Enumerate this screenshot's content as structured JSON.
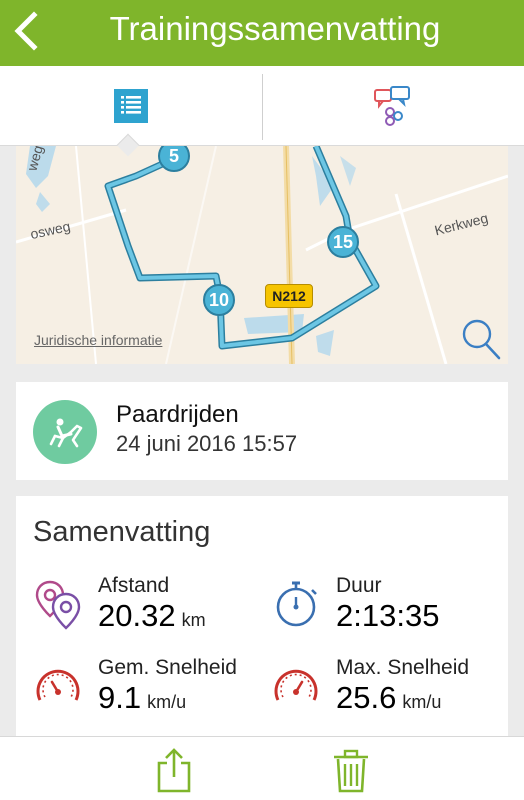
{
  "header": {
    "title": "Trainingssamenvatting",
    "back_icon": "chevron-left-icon",
    "color": "#7fb52b"
  },
  "tabs": [
    {
      "icon": "list-icon",
      "selected": true
    },
    {
      "icon": "chat-bubbles-icon",
      "selected": false
    }
  ],
  "map": {
    "roads": [
      "Kerkweg",
      "osweg",
      "weg"
    ],
    "highway": "N212",
    "legal_link": "Juridische informatie",
    "markers": [
      "5",
      "10",
      "15"
    ],
    "zoom_icon": "magnifier-icon",
    "route_color": "#4ab3d6"
  },
  "activity": {
    "name": "Paardrijden",
    "datetime": "24 juni 2016 15:57",
    "icon": "horse-riding-icon",
    "icon_color": "#6fcba0"
  },
  "summary": {
    "title": "Samenvatting",
    "stats": {
      "afstand": {
        "label": "Afstand",
        "value": "20.32",
        "unit": "km",
        "icon": "map-pins-icon"
      },
      "duur": {
        "label": "Duur",
        "value": "2:13:35",
        "unit": "",
        "icon": "stopwatch-icon"
      },
      "gem": {
        "label": "Gem. Snelheid",
        "value": "9.1",
        "unit": "km/u",
        "icon": "speedometer-icon"
      },
      "max": {
        "label": "Max. Snelheid",
        "value": "25.6",
        "unit": "km/u",
        "icon": "speedometer-icon"
      }
    }
  },
  "toolbar": {
    "share_icon": "share-icon",
    "delete_icon": "trash-icon",
    "color": "#7fb52b"
  }
}
